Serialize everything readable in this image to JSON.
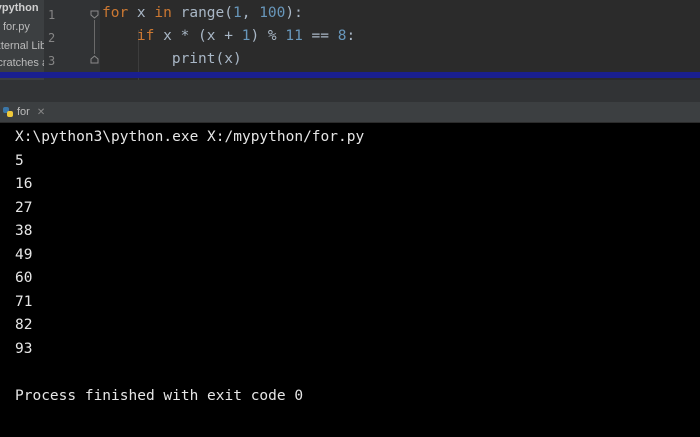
{
  "project_panel": {
    "items": [
      {
        "label": "mypython",
        "bold": true,
        "selected": false
      },
      {
        "label": "for.py",
        "bold": false,
        "selected": false
      },
      {
        "label": "External Libraries",
        "bold": false,
        "selected": false
      },
      {
        "label": "Scratches and Consoles",
        "bold": false,
        "selected": false
      }
    ]
  },
  "editor": {
    "line_numbers": [
      "1",
      "2",
      "3"
    ],
    "code": [
      {
        "indent": "",
        "tokens": [
          {
            "t": "for",
            "c": "kw"
          },
          {
            "t": " x ",
            "c": ""
          },
          {
            "t": "in",
            "c": "kw"
          },
          {
            "t": " range(",
            "c": ""
          },
          {
            "t": "1",
            "c": "num"
          },
          {
            "t": ", ",
            "c": ""
          },
          {
            "t": "100",
            "c": "num"
          },
          {
            "t": "):",
            "c": ""
          }
        ]
      },
      {
        "indent": "    ",
        "tokens": [
          {
            "t": "if",
            "c": "kw"
          },
          {
            "t": " x * (x + ",
            "c": ""
          },
          {
            "t": "1",
            "c": "num"
          },
          {
            "t": ") % ",
            "c": ""
          },
          {
            "t": "11",
            "c": "num"
          },
          {
            "t": " == ",
            "c": ""
          },
          {
            "t": "8",
            "c": "num"
          },
          {
            "t": ":",
            "c": ""
          }
        ]
      },
      {
        "indent": "        ",
        "tokens": [
          {
            "t": "print",
            "c": "fn"
          },
          {
            "t": "(x)",
            "c": ""
          }
        ]
      }
    ]
  },
  "run_tab": {
    "label": "for",
    "close_icon": "close-icon",
    "icon": "python-icon"
  },
  "console": {
    "lines": [
      "X:\\python3\\python.exe X:/mypython/for.py",
      "5",
      "16",
      "27",
      "38",
      "49",
      "60",
      "71",
      "82",
      "93",
      "",
      "Process finished with exit code 0"
    ]
  },
  "colors": {
    "keyword": "#cc7832",
    "number": "#6897bb",
    "text": "#a9b7c6",
    "console_bg": "#000000",
    "console_text": "#e6e6e6"
  }
}
